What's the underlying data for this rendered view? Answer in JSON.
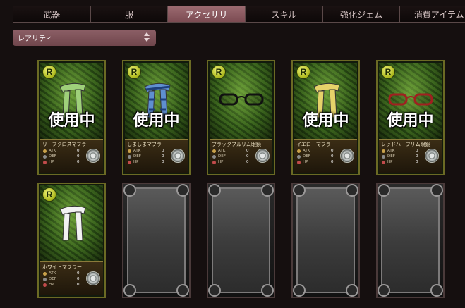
{
  "tabs": [
    {
      "label": "武器",
      "active": false
    },
    {
      "label": "服",
      "active": false
    },
    {
      "label": "アクセサリ",
      "active": true
    },
    {
      "label": "スキル",
      "active": false
    },
    {
      "label": "強化ジェム",
      "active": false
    },
    {
      "label": "消費アイテム",
      "active": false
    }
  ],
  "filter": {
    "label": "レアリティ"
  },
  "stat_labels": {
    "atk": "ATK",
    "def": "DEF",
    "hp": "HP"
  },
  "in_use_label": "使用中",
  "rarity_badge": "R",
  "items": [
    {
      "name": "リーフクロスマフラー",
      "in_use": true,
      "atk": "0",
      "def": "0",
      "hp": "0",
      "icon": "green-scarf",
      "color": "#9fd07a"
    },
    {
      "name": "しましまマフラー",
      "in_use": true,
      "atk": "0",
      "def": "0",
      "hp": "0",
      "icon": "striped-scarf",
      "color": "#5f8fd0"
    },
    {
      "name": "ブラックフルリム眼鏡",
      "in_use": false,
      "atk": "0",
      "def": "0",
      "hp": "0",
      "icon": "black-glasses",
      "color": "#111111"
    },
    {
      "name": "イエローマフラー",
      "in_use": true,
      "atk": "0",
      "def": "0",
      "hp": "0",
      "icon": "yellow-scarf",
      "color": "#e6d26a"
    },
    {
      "name": "レッドハーフリム眼鏡",
      "in_use": true,
      "atk": "0",
      "def": "0",
      "hp": "0",
      "icon": "red-glasses",
      "color": "#a02020"
    },
    {
      "name": "ホワイトマフラー",
      "in_use": false,
      "atk": "0",
      "def": "0",
      "hp": "0",
      "icon": "white-scarf",
      "color": "#f2f2f2"
    }
  ],
  "empty_slots": 4
}
